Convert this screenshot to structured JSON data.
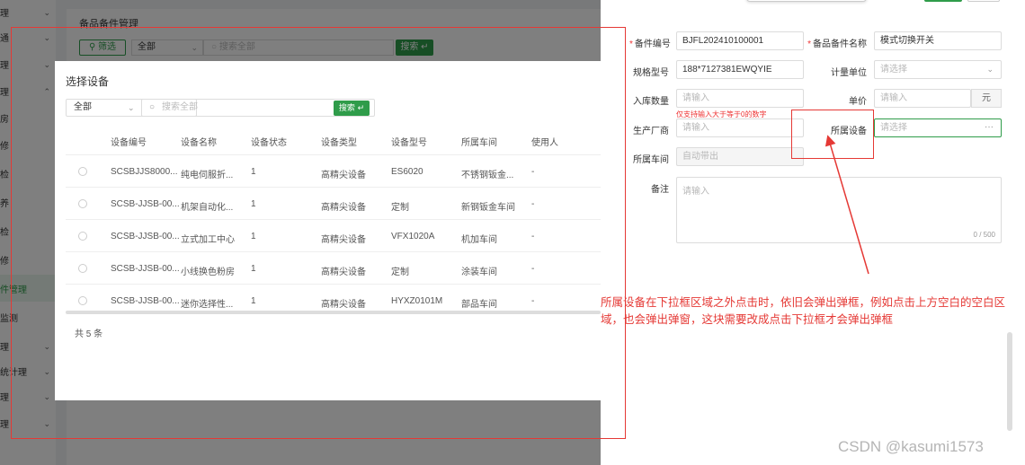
{
  "background": {
    "page_title": "备品备件管理",
    "filter_label": "筛选",
    "select_value": "全部",
    "search_placeholder": "搜索全部",
    "search_label": "搜索",
    "sidebar_items": [
      "理",
      "通",
      "理",
      "理",
      "房",
      "修",
      "检",
      "养",
      "检",
      "修",
      "件管理",
      "监测",
      "理",
      "统计理",
      "理",
      "理"
    ]
  },
  "modal": {
    "title": "选择设备",
    "select_value": "全部",
    "search_placeholder": "搜索全部",
    "search_label": "搜索",
    "columns": [
      "设备编号",
      "设备名称",
      "设备状态",
      "设备类型",
      "设备型号",
      "所属车间",
      "使用人"
    ],
    "rows": [
      [
        "SCSBJJS8000...",
        "纯电伺服折...",
        "1",
        "高精尖设备",
        "ES6020",
        "不锈钢钣金...",
        "-"
      ],
      [
        "SCSB-JJSB-00...",
        "机架自动化...",
        "1",
        "高精尖设备",
        "定制",
        "新钢钣金车间",
        "-"
      ],
      [
        "SCSB-JJSB-00...",
        "立式加工中心",
        "1",
        "高精尖设备",
        "VFX1020A",
        "机加车间",
        "-"
      ],
      [
        "SCSB-JJSB-00...",
        "小线换色粉房",
        "1",
        "高精尖设备",
        "定制",
        "涂装车间",
        "-"
      ],
      [
        "SCSB-JJSB-00...",
        "迷你选择性...",
        "1",
        "高精尖设备",
        "HYXZ0101M",
        "部品车间",
        "-"
      ]
    ],
    "total": "共 5 条"
  },
  "form": {
    "part_no_label": "备件编号",
    "part_no_value": "BJFL202410100001",
    "part_name_label": "备品备件名称",
    "part_name_value": "模式切换开关",
    "spec_label": "规格型号",
    "spec_value": "188*7127381EWQYIE",
    "unit_label": "计量单位",
    "unit_placeholder": "请选择",
    "qty_label": "入库数量",
    "qty_placeholder": "请输入",
    "qty_hint": "仅支持输入大于等于0的数字",
    "price_label": "单价",
    "price_placeholder": "请输入",
    "price_unit": "元",
    "maker_label": "生产厂商",
    "maker_placeholder": "请输入",
    "device_label": "所属设备",
    "device_placeholder": "请选择",
    "device_more": "···",
    "workshop_label": "所属车间",
    "workshop_placeholder": "自动带出",
    "remark_label": "备注",
    "remark_placeholder": "请输入",
    "remark_counter": "0 / 500"
  },
  "annotation": {
    "text": "所属设备在下拉框区域之外点击时，依旧会弹出弹框，例如点击上方空白的空白区域，也会弹出弹窗，这块需要改成点击下拉框才会弹出弹框",
    "color": "#e53935"
  },
  "watermark": "CSDN @kasumi1573",
  "colors": {
    "primary": "#2f9c4a",
    "annotation": "#e53935"
  }
}
